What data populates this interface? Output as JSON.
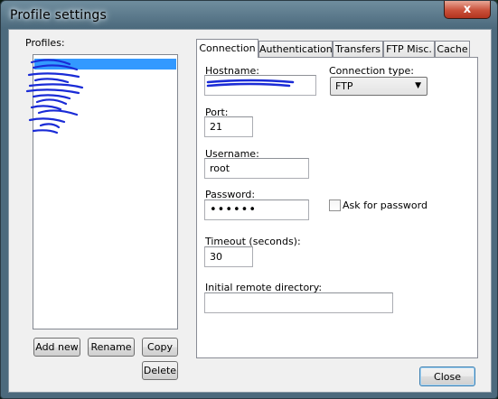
{
  "window": {
    "title": "Profile settings",
    "close_glyph": "x"
  },
  "profiles": {
    "label": "Profiles:",
    "items": [
      "",
      "",
      "",
      "",
      "",
      "",
      ""
    ],
    "selected_index": 0
  },
  "buttons": {
    "add_new": "Add new",
    "rename": "Rename",
    "copy": "Copy",
    "delete": "Delete",
    "close": "Close"
  },
  "tabs": [
    {
      "label": "Connection",
      "active": true
    },
    {
      "label": "Authentication",
      "active": false
    },
    {
      "label": "Transfers",
      "active": false
    },
    {
      "label": "FTP Misc.",
      "active": false
    },
    {
      "label": "Cache",
      "active": false
    }
  ],
  "connection": {
    "hostname_label": "Hostname:",
    "hostname_value": "",
    "conn_type_label": "Connection type:",
    "conn_type_value": "FTP",
    "port_label": "Port:",
    "port_value": "21",
    "username_label": "Username:",
    "username_value": "root",
    "password_label": "Password:",
    "password_value": "••••••",
    "ask_password_label": "Ask for password",
    "timeout_label": "Timeout (seconds):",
    "timeout_value": "30",
    "remote_dir_label": "Initial remote directory:",
    "remote_dir_value": ""
  },
  "colors": {
    "selection": "#3399ff",
    "redaction": "#1a2bd6"
  }
}
